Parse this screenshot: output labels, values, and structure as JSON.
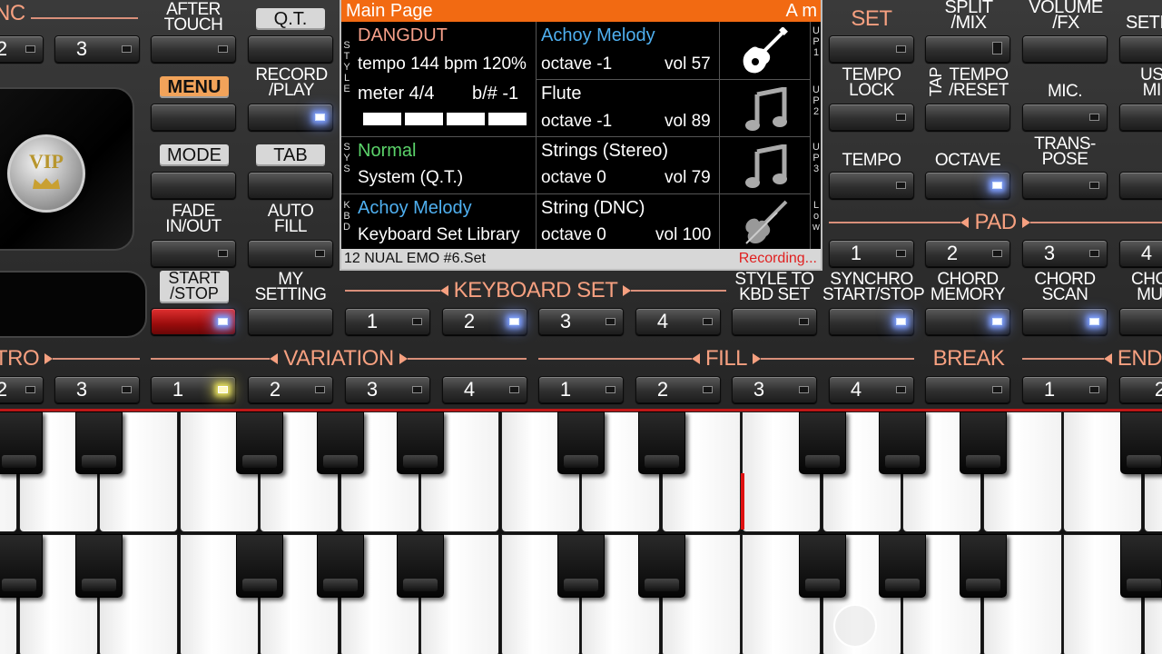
{
  "header": {
    "after_touch": "AFTER\nTOUCH",
    "qt": "Q.T.",
    "nc": "NC",
    "set": "SET",
    "split_mix": "SPLIT\n/MIX",
    "volume_fx": "VOLUME\n/FX",
    "setting_cut": "SETI"
  },
  "left": {
    "menu": "MENU",
    "record_play": "RECORD\n/PLAY",
    "mode": "MODE",
    "tab": "TAB",
    "fade_in_out": "FADE\nIN/OUT",
    "auto_fill": "AUTO\nFILL",
    "start_stop": "START\n/STOP",
    "my_setting": "MY\nSETTING",
    "vip": "VIP"
  },
  "display": {
    "title": "Main Page",
    "chord": "A m",
    "style_name": "DANGDUT",
    "tempo": "tempo 144 bpm 120%",
    "meter": "meter 4/4",
    "key": "b/# -1",
    "sys_name": "Normal",
    "sys_sub": "System (Q.T.)",
    "kbd_name": "Achoy Melody",
    "kbd_sub": "Keyboard Set Library",
    "file": "12 NUAL EMO #6.Set",
    "status": "Recording...",
    "side_style": "STYLE",
    "side_sys": "SYS",
    "side_kbd": "KBD",
    "parts": [
      {
        "name": "Achoy Melody",
        "octave": "octave -1",
        "vol": "vol 57",
        "side": "UP1",
        "icon": "guitar-icon"
      },
      {
        "name": "Flute",
        "octave": "octave -1",
        "vol": "vol 89",
        "side": "UP2",
        "icon": "music-note-icon"
      },
      {
        "name": "Strings (Stereo)",
        "octave": "octave  0",
        "vol": "vol 79",
        "side": "UP3",
        "icon": "music-note-icon"
      },
      {
        "name": "String (DNC)",
        "octave": "octave  0",
        "vol": "vol 100",
        "side": "Low",
        "icon": "violin-icon"
      }
    ]
  },
  "right": {
    "tempo_lock": "TEMPO\nLOCK",
    "tap_tempo_reset": "TEMPO\n/RESET",
    "tap": "TAP",
    "mic": "MIC.",
    "us_cut": "US\nMI",
    "tempo": "TEMPO",
    "octave": "OCTAVE",
    "transpose": "TRANS-\nPOSE",
    "pad": "PAD",
    "pad_buttons": [
      "1",
      "2",
      "3",
      "4"
    ],
    "style_to_kbd_set": "STYLE TO\nKBD SET",
    "synchro_start_stop": "SYNCHRO\nSTART/STOP",
    "chord_memory": "CHORD\nMEMORY",
    "chord_scan": "CHORD\nSCAN",
    "chord_mu_cut": "CHO\nMU"
  },
  "keyboard_set": {
    "title": "KEYBOARD SET",
    "buttons": [
      "1",
      "2",
      "3",
      "4"
    ]
  },
  "bottom_row": {
    "intro": "TRO",
    "variation": "VARIATION",
    "fill": "FILL",
    "break": "BREAK",
    "ending": "END",
    "intro_buttons": [
      "2",
      "3"
    ],
    "variation_buttons": [
      "1",
      "2",
      "3",
      "4"
    ],
    "fill_buttons": [
      "1",
      "2",
      "3",
      "4"
    ],
    "ending_buttons": [
      "1",
      "2"
    ],
    "top_left_button": "2",
    "top_second_button": "3"
  }
}
